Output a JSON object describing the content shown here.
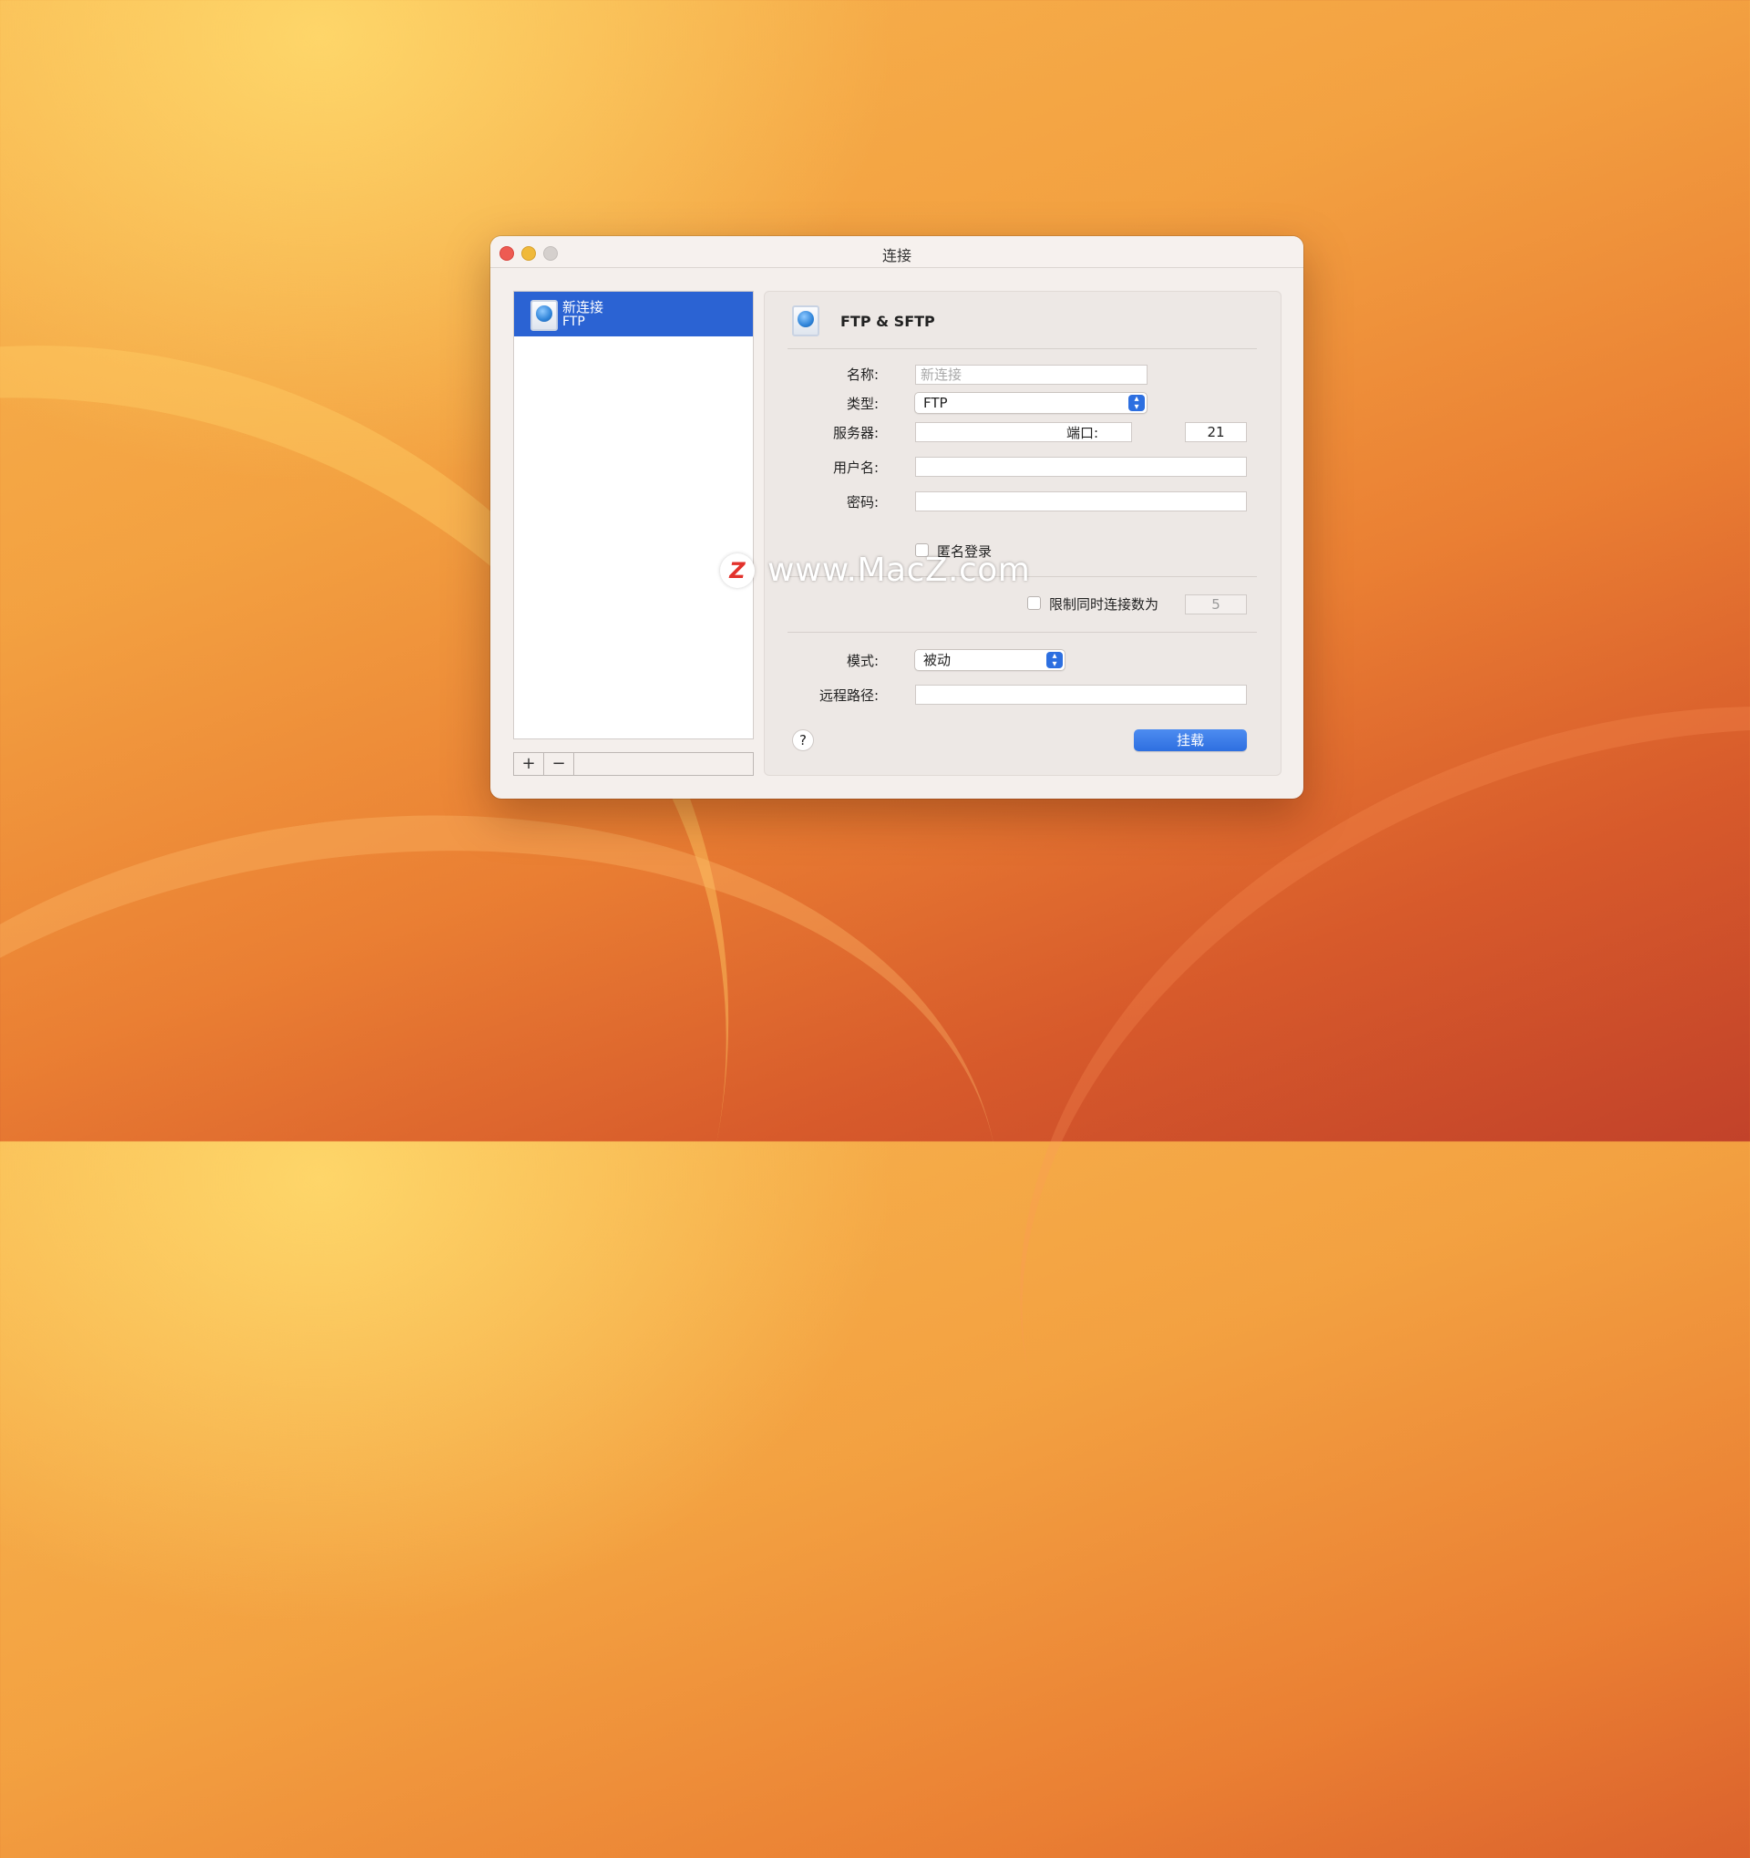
{
  "window": {
    "title": "连接"
  },
  "connections": [
    {
      "name": "新连接",
      "type": "FTP"
    }
  ],
  "list_controls": {
    "add": "+",
    "remove": "−"
  },
  "panel": {
    "title": "FTP & SFTP",
    "name_label": "名称:",
    "name_placeholder": "新连接",
    "type_label": "类型:",
    "type_value": "FTP",
    "server_label": "服务器:",
    "server_value": "",
    "port_label": "端口:",
    "port_value": "21",
    "username_label": "用户名:",
    "username_value": "",
    "password_label": "密码:",
    "password_value": "",
    "anonymous_label": "匿名登录",
    "limit_label": "限制同时连接数为",
    "limit_value": "5",
    "mode_label": "模式:",
    "mode_value": "被动",
    "remote_path_label": "远程路径:",
    "remote_path_value": "",
    "help_label": "?",
    "mount_label": "挂载"
  },
  "watermark": {
    "logo": "Z",
    "text": "www.MacZ.com"
  },
  "colors": {
    "accent": "#2b63d3",
    "button": "#2e6fe0",
    "close": "#ee5b52",
    "minimize": "#f0b93a"
  }
}
